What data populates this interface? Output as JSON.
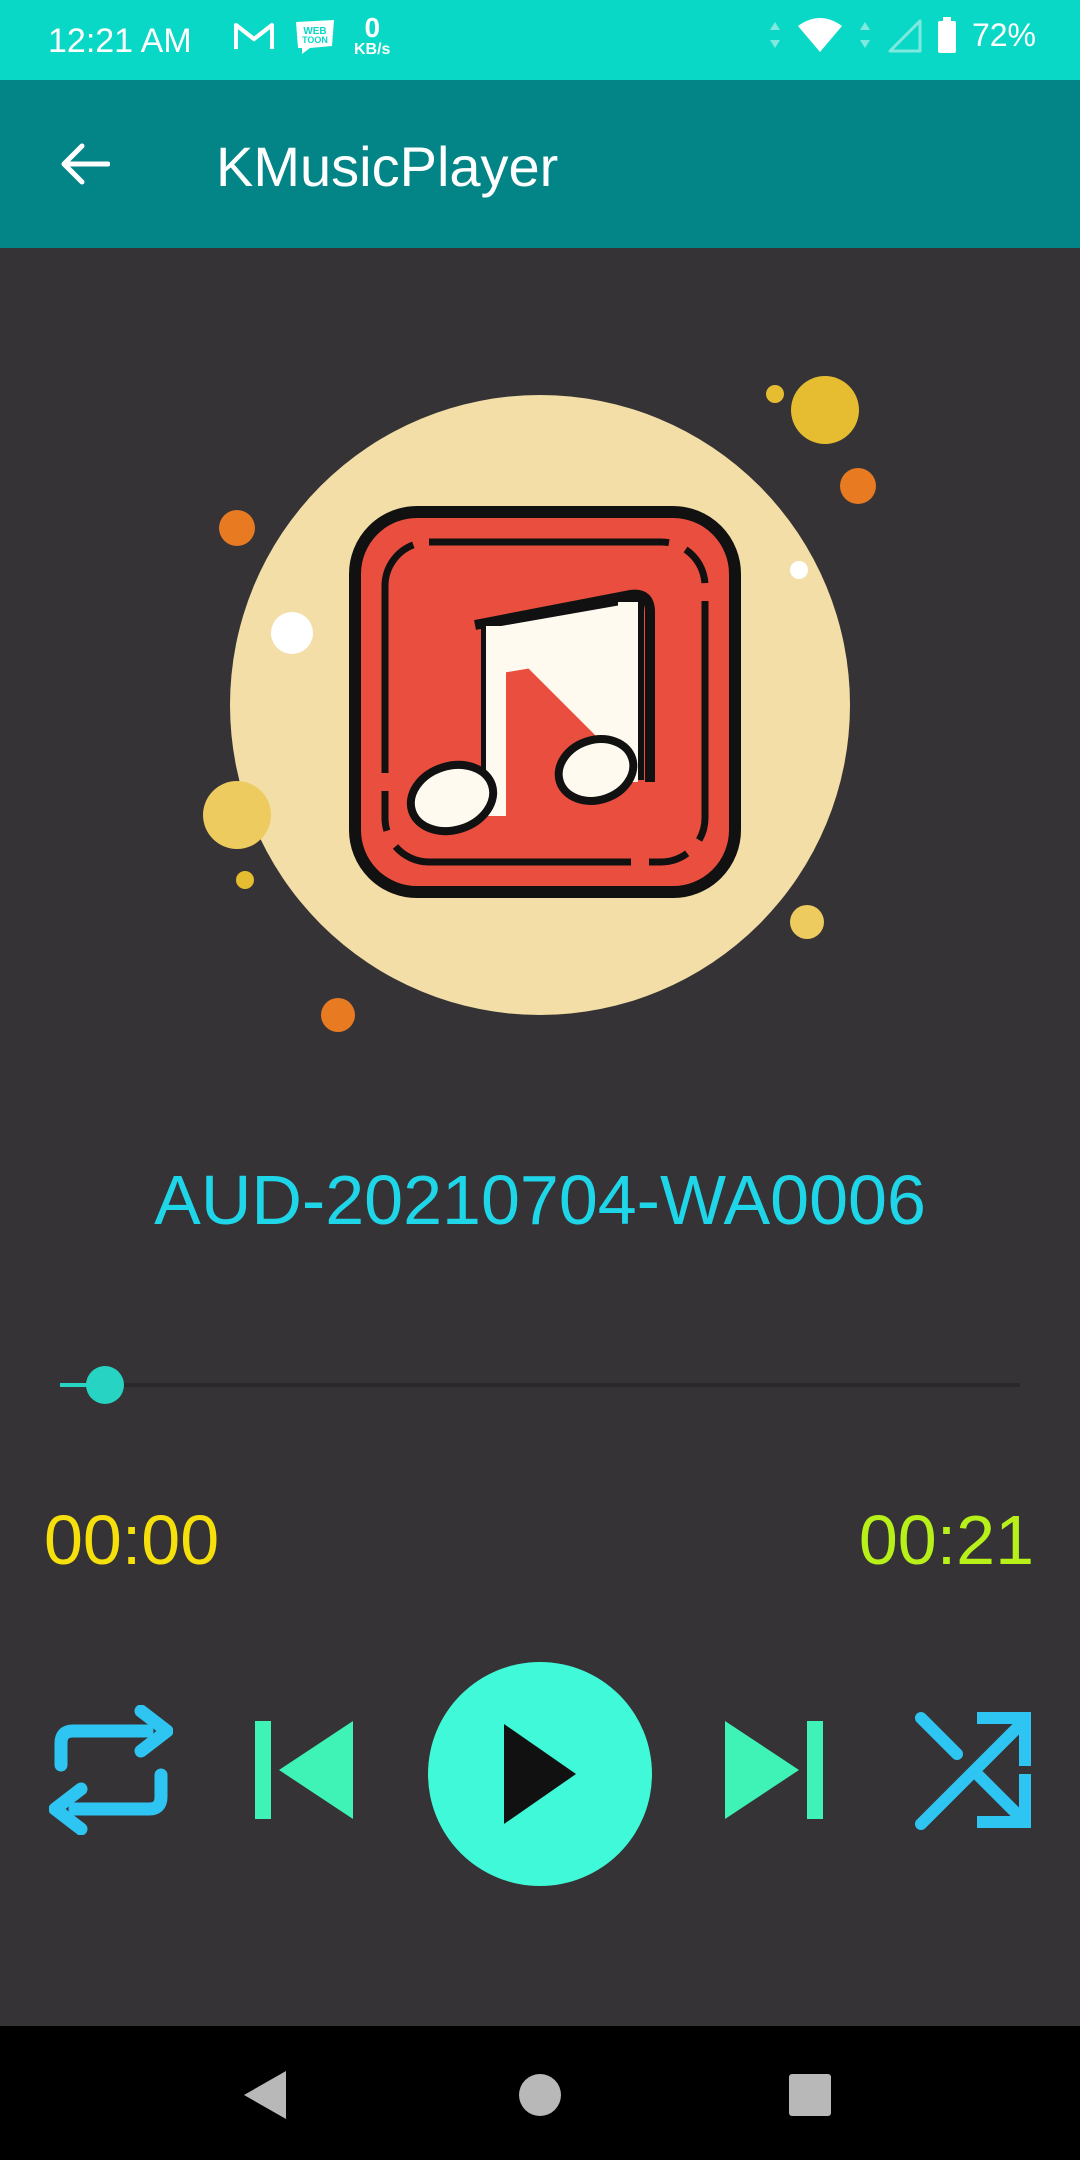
{
  "status_bar": {
    "time": "12:21 AM",
    "speed_value": "0",
    "speed_unit": "KB/s",
    "battery": "72%",
    "icons": [
      "gmail-icon",
      "webtoon-icon",
      "wifi-icon",
      "signal-icon",
      "battery-icon"
    ]
  },
  "app_bar": {
    "title": "KMusicPlayer"
  },
  "player": {
    "track_title": "AUD-20210704-WA0006",
    "current_time": "00:00",
    "total_time": "00:21",
    "progress_fraction": 0.0
  },
  "colors": {
    "status_bar": "#0ad8c6",
    "app_bar": "#038587",
    "background": "#353335",
    "track_title": "#1fd6e8",
    "current_time": "#f6e00c",
    "total_time": "#b8f01a",
    "play_button": "#3ff9d8",
    "repeat_shuffle": "#2ec5f2",
    "prev_next": "#3ff2b6"
  }
}
